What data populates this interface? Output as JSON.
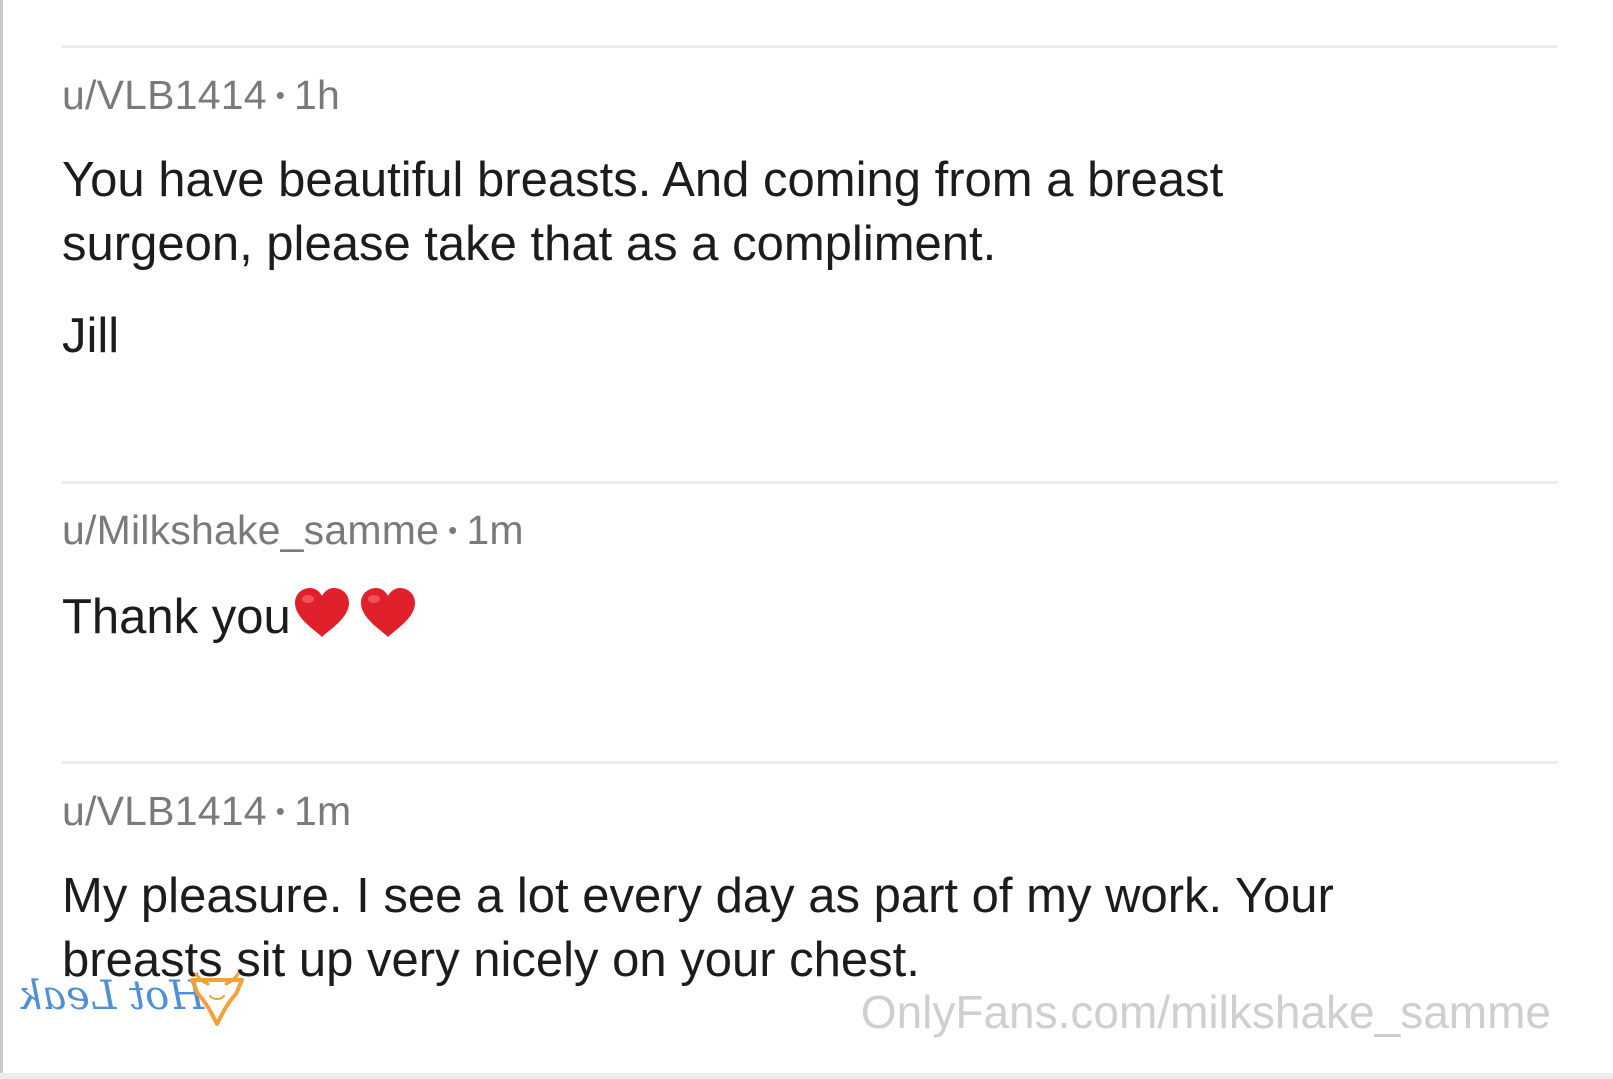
{
  "comments": [
    {
      "username": "u/VLB1414",
      "separator": "•",
      "time": "1h",
      "lines": [
        "You have beautiful breasts. And coming from a breast",
        "surgeon, please take that as a compliment."
      ],
      "signature": "Jill"
    },
    {
      "username": "u/Milkshake_samme",
      "separator": "•",
      "time": "1m",
      "text": "Thank you",
      "emoji": [
        "red-heart",
        "red-heart"
      ]
    },
    {
      "username": "u/VLB1414",
      "separator": "•",
      "time": "1m",
      "lines": [
        "My pleasure. I see a lot every day as part of my work. Your",
        "breasts sit up very nicely on your chest."
      ]
    }
  ],
  "watermarks": {
    "logo_text": "Hot Leak",
    "logo_icon": "panties-icon",
    "url": "OnlyFans.com/milkshake_samme"
  },
  "colors": {
    "meta_text": "#7a7a7a",
    "body_text": "#1c1c1c",
    "heart": "#e0202a",
    "logo_blue": "#4f8fd6",
    "logo_orange": "#f3a23b",
    "url_watermark": "#cfcfcf"
  }
}
